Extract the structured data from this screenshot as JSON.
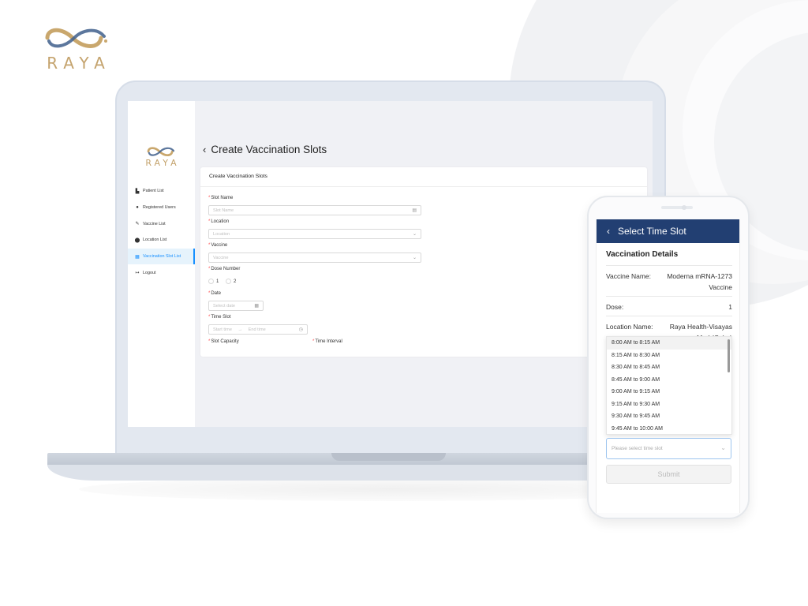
{
  "brand": {
    "name": "RAYA"
  },
  "admin": {
    "logo_text": "RAYA",
    "sidebar": [
      {
        "label": "Patient List",
        "icon": "patient-list-icon",
        "glyph": "▙"
      },
      {
        "label": "Registered Users",
        "icon": "user-icon",
        "glyph": "●"
      },
      {
        "label": "Vaccine List",
        "icon": "syringe-icon",
        "glyph": "✎"
      },
      {
        "label": "Location List",
        "icon": "location-pin-icon",
        "glyph": "⬤"
      },
      {
        "label": "Vaccination Slot List",
        "icon": "building-icon",
        "glyph": "▦",
        "active": true
      },
      {
        "label": "Logout",
        "icon": "logout-icon",
        "glyph": "↦"
      }
    ],
    "page_title": "Create Vaccination Slots",
    "card_title": "Create Vaccination Slots",
    "form": {
      "slot_name": {
        "label": "Slot Name",
        "placeholder": "Slot Name"
      },
      "location": {
        "label": "Location",
        "placeholder": "Location"
      },
      "vaccine": {
        "label": "Vaccine",
        "placeholder": "Vaccine"
      },
      "dose_number": {
        "label": "Dose Number",
        "options": [
          "1",
          "2"
        ]
      },
      "date": {
        "label": "Date",
        "placeholder": "Select date"
      },
      "time_slot": {
        "label": "Time Slot",
        "start_placeholder": "Start time",
        "end_placeholder": "End time",
        "separator": "→"
      },
      "slot_capacity": {
        "label": "Slot Capacity"
      },
      "time_interval": {
        "label": "Time Interval"
      }
    },
    "accent_color": "#1890ff"
  },
  "mobile": {
    "header_title": "Select Time Slot",
    "header_color": "#223f72",
    "section_title": "Vaccination Details",
    "details": [
      {
        "key": "Vaccine Name:",
        "value": "Moderna mRNA-1273 Vaccine"
      },
      {
        "key": "Dose:",
        "value": "1"
      },
      {
        "key": "Location Name:",
        "value": "Raya Health-Visayas Med (Cebu)"
      }
    ],
    "time_options": [
      "8:00 AM to 8:15 AM",
      "8:15 AM to 8:30 AM",
      "8:30 AM to 8:45 AM",
      "8:45 AM to 9:00 AM",
      "9:00 AM to 9:15 AM",
      "9:15 AM to 9:30 AM",
      "9:30 AM to 9:45 AM",
      "9:45 AM to 10:00 AM"
    ],
    "select_placeholder": "Please select time slot",
    "submit_label": "Submit"
  }
}
